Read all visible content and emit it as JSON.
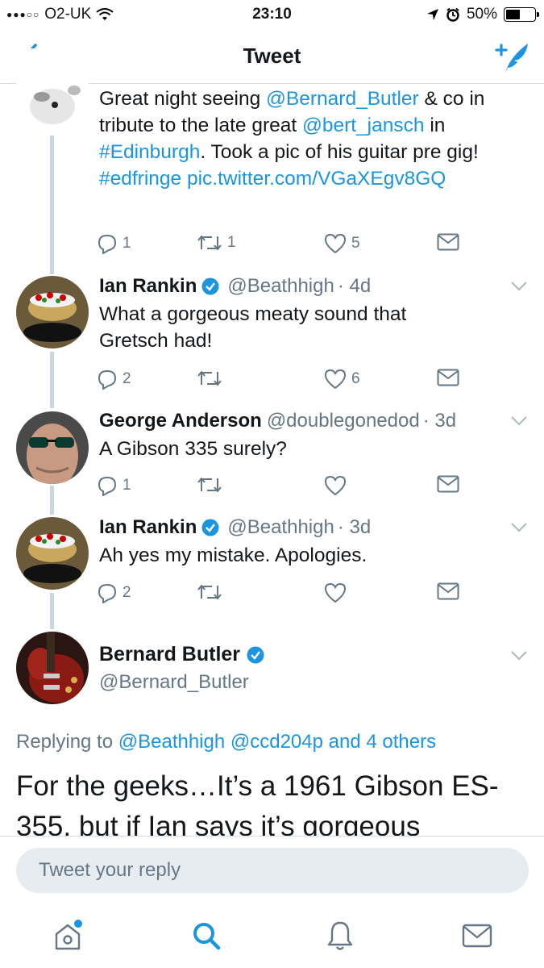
{
  "status_bar": {
    "signal": "●●●○○",
    "carrier": "O2-UK",
    "time": "23:10",
    "battery": "50%"
  },
  "nav": {
    "title": "Tweet"
  },
  "tweets": [
    {
      "text_parts": [
        {
          "t": "Great night seeing "
        },
        {
          "t": "@Bernard_Butler",
          "link": true
        },
        {
          "t": " & co in tribute to the late great "
        },
        {
          "t": "@bert_jansch",
          "link": true
        },
        {
          "t": " in "
        },
        {
          "t": "#Edinburgh",
          "link": true
        },
        {
          "t": ". Took a pic of his guitar pre gig! "
        },
        {
          "t": "#edfringe",
          "link": true
        },
        {
          "t": " "
        },
        {
          "t": "pic.twitter.com/VGaXEgv8GQ",
          "link": true
        }
      ],
      "replies": "1",
      "retweets": "1",
      "likes": "5"
    },
    {
      "name": "Ian Rankin",
      "verified": true,
      "handle": "@Beathhigh",
      "time": "· 4d",
      "text": "What a gorgeous meaty sound that Gretsch had!",
      "replies": "2",
      "retweets": "",
      "likes": "6"
    },
    {
      "name": "George Anderson",
      "verified": false,
      "handle": "@doublegonedod",
      "time": "· 3d",
      "text": "A Gibson 335 surely?",
      "replies": "1",
      "retweets": "",
      "likes": ""
    },
    {
      "name": "Ian Rankin",
      "verified": true,
      "handle": "@Beathhigh",
      "time": "· 3d",
      "text": "Ah yes my mistake. Apologies.",
      "replies": "2",
      "retweets": "",
      "likes": ""
    }
  ],
  "focal": {
    "name": "Bernard Butler",
    "handle": "@Bernard_Butler",
    "replying_prefix": "Replying to ",
    "replying_to": "@Beathhigh @ccd204p and 4 others",
    "text": "For the geeks…It’s a 1961 Gibson ES-355, but if Ian says it’s gorgeous"
  },
  "reply": {
    "placeholder": "Tweet your reply"
  },
  "colors": {
    "brand": "#1b95e0",
    "muted": "#657786",
    "thread_line": "#ccd6dd"
  }
}
